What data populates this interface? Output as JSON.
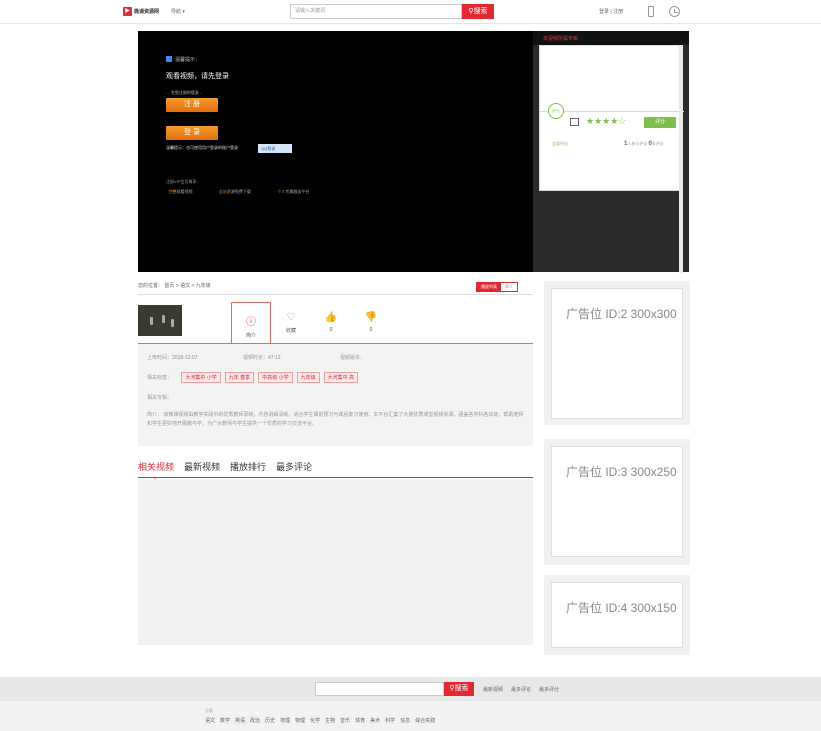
{
  "header": {
    "logo_text": "微课资源网",
    "category_label": "导航 ▾",
    "search_placeholder": "请输入关键词",
    "search_button": "搜索",
    "login": "登录",
    "register": "注册"
  },
  "player": {
    "notice": "温馨提示：",
    "title": "观看视频，请先登录",
    "sub": "- - 先免注册的登录 -",
    "register_button": "注 册",
    "login_button": "登 录",
    "tip": "温馨提示：也可使用用户登录的账户登录",
    "qq_button": "QQ登录",
    "benefit_title": "注册VIP会员尊享：",
    "benefits": [
      {
        "hl": "· 完整",
        "rest": "观看视频"
      },
      {
        "hl": "· 全站",
        "rest": "资源免费下载"
      },
      {
        "hl": "· 个人",
        "rest": "专属服务平台"
      }
    ]
  },
  "playlist": {
    "header": "本视频所属专辑",
    "rate_label": "评分",
    "stars": "★★★★☆",
    "rate_button": "评分",
    "stat_left": "全部评论",
    "stat_right_count": "1",
    "stat_right_label": "人参与评论",
    "stat_right_count2": "0",
    "stat_right_label2": "条评论"
  },
  "breadcrumb": "您的位置：  首页  >  语文  >  九年级",
  "view_switch": {
    "on": "播放列表",
    "off": "简介"
  },
  "actions": [
    {
      "icon": "ⓘ",
      "label": "简介"
    },
    {
      "icon": "♡",
      "label": "收藏"
    },
    {
      "icon": "👍",
      "label": "0"
    },
    {
      "icon": "👎",
      "label": "0"
    }
  ],
  "meta": {
    "upload_label": "上传时间：",
    "upload_value": "2018-12-07",
    "duration_label": "视频时长：",
    "duration_value": "47:12",
    "version_label": "视频版本：",
    "version_value": "",
    "tags_label": "相关标签：",
    "tags": [
      "大河集中 小学",
      "九年 春季",
      "中高级 小学",
      "九年级",
      "大河集中 高"
    ],
    "topic_label": "相关专辑：",
    "intro": "简介：  该微课视频由教学实践中的优秀教师录制，内容讲解清晰，适合学生课前预习与课后复习使用。本平台汇集了大量优质课堂视频资源，涵盖各学科各年级，帮助老师和学生更好地开展教与学，为广大教师与学生提供一个优质的学习交流平台。"
  },
  "tabs": [
    "相关视频",
    "最新视频",
    "播放排行",
    "最多评论"
  ],
  "ads": [
    {
      "label": "广告位 ID:2 300x300"
    },
    {
      "label": "广告位 ID:3 300x250"
    },
    {
      "label": "广告位 ID:4 300x150"
    }
  ],
  "footer": {
    "search_button": "搜索",
    "links": [
      "最新视频",
      "最多评论",
      "最多评分"
    ],
    "cat_title": "分类",
    "cats": [
      "语文",
      "数学",
      "英语",
      "政治",
      "历史",
      "地理",
      "物理",
      "化学",
      "生物",
      "音乐",
      "体育",
      "美术",
      "科学",
      "信息",
      "综合实践"
    ]
  }
}
